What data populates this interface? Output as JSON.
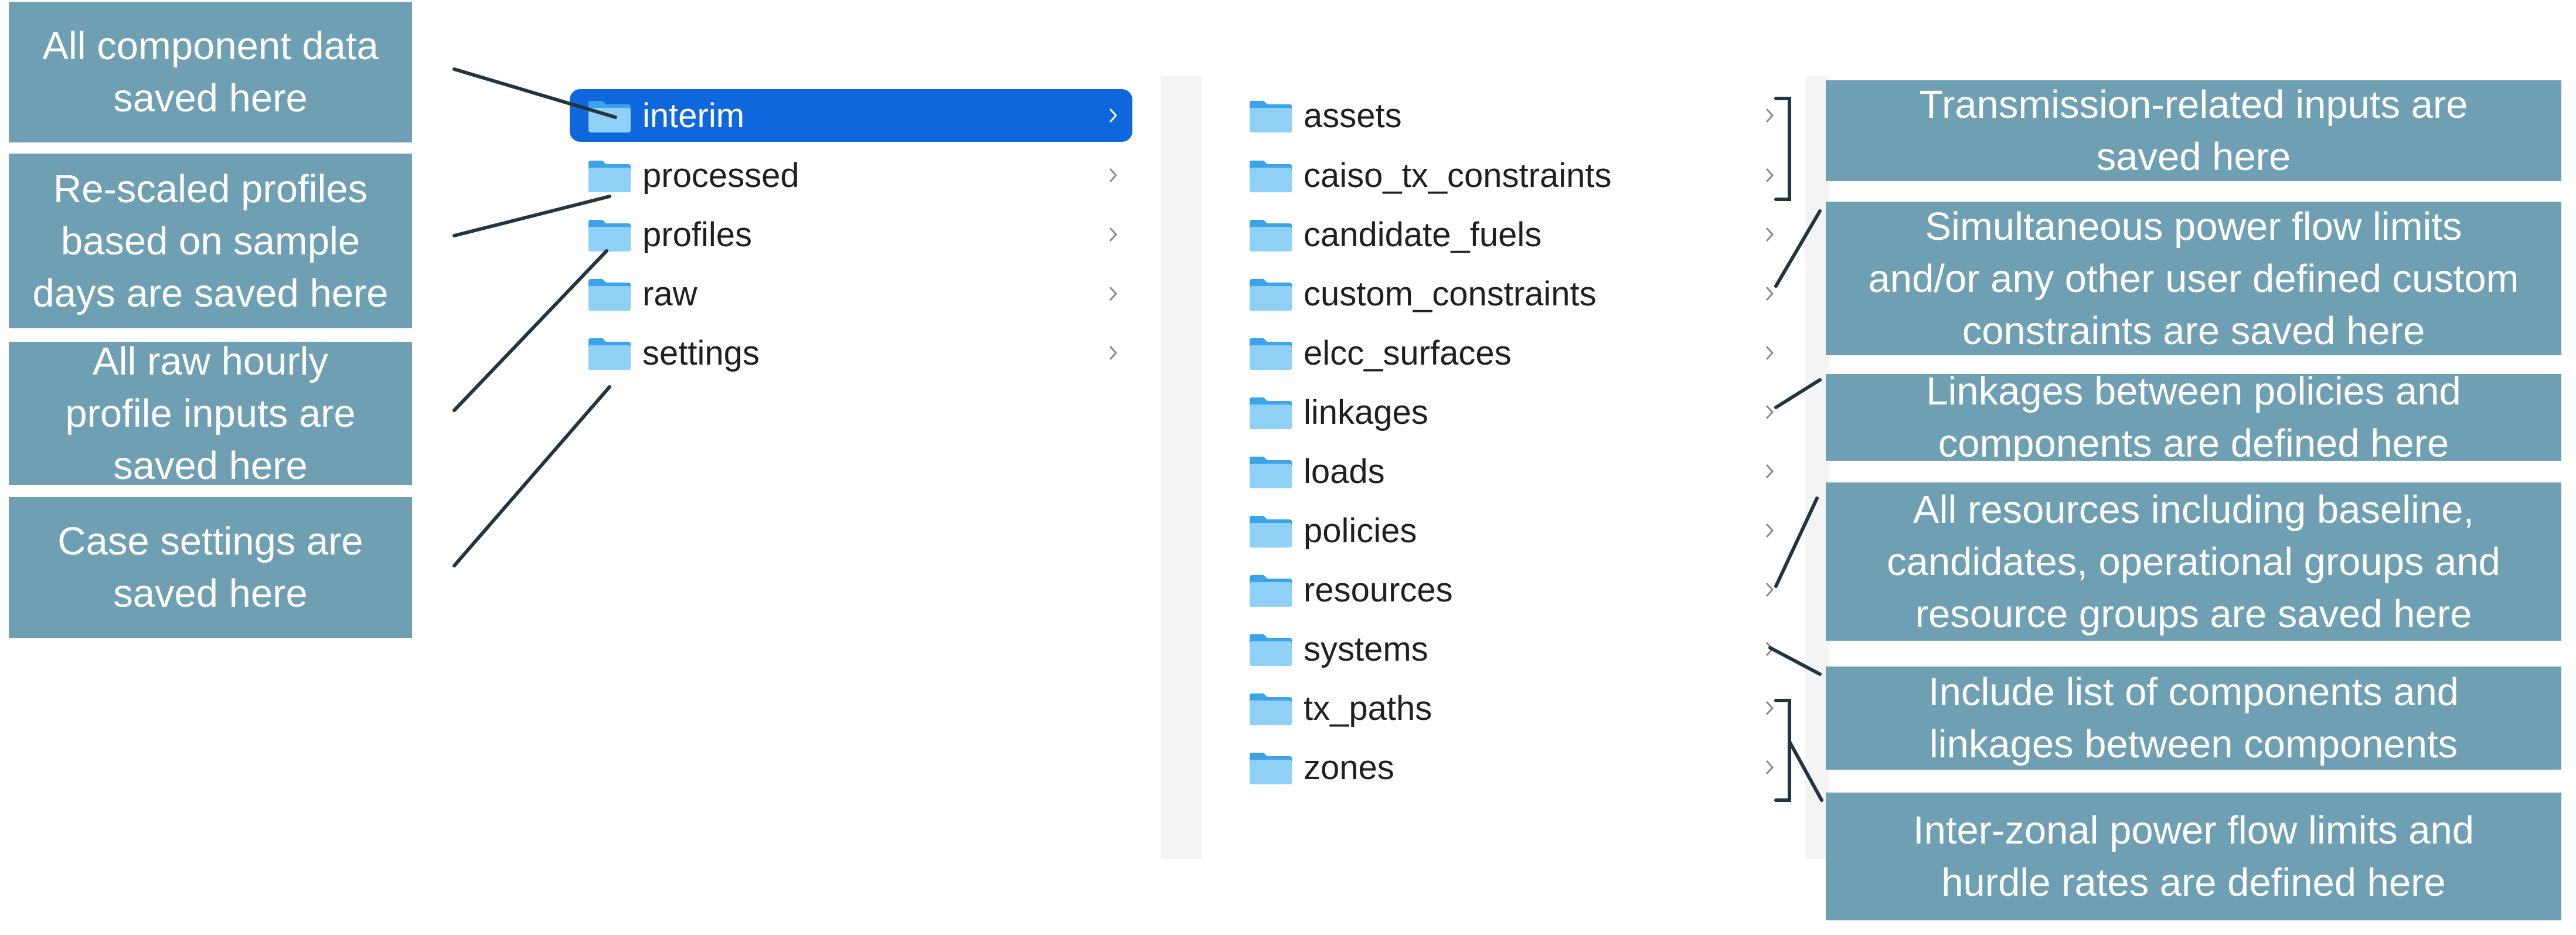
{
  "left_pane": {
    "items": [
      {
        "label": "interim",
        "selected": true
      },
      {
        "label": "processed",
        "selected": false
      },
      {
        "label": "profiles",
        "selected": false
      },
      {
        "label": "raw",
        "selected": false
      },
      {
        "label": "settings",
        "selected": false
      }
    ]
  },
  "right_pane": {
    "items": [
      {
        "label": "assets"
      },
      {
        "label": "caiso_tx_constraints"
      },
      {
        "label": "candidate_fuels"
      },
      {
        "label": "custom_constraints"
      },
      {
        "label": "elcc_surfaces"
      },
      {
        "label": "linkages"
      },
      {
        "label": "loads"
      },
      {
        "label": "policies"
      },
      {
        "label": "resources"
      },
      {
        "label": "systems"
      },
      {
        "label": "tx_paths"
      },
      {
        "label": "zones"
      }
    ]
  },
  "left_callouts": [
    {
      "lines": [
        "All component data",
        "saved here"
      ]
    },
    {
      "lines": [
        "Re-scaled profiles",
        "based on sample",
        "days are saved here"
      ]
    },
    {
      "lines": [
        "All raw hourly",
        "profile inputs are",
        "saved here"
      ]
    },
    {
      "lines": [
        "Case settings are",
        "saved here"
      ]
    }
  ],
  "right_callouts": [
    {
      "lines": [
        "Transmission-related inputs are",
        "saved here"
      ]
    },
    {
      "lines": [
        "Simultaneous power flow limits",
        "and/or any other user defined custom",
        "constraints are saved here"
      ]
    },
    {
      "lines": [
        "Linkages between policies and",
        "components are defined here"
      ]
    },
    {
      "lines": [
        "All resources including baseline,",
        "candidates, operational groups and",
        "resource groups are saved here"
      ]
    },
    {
      "lines": [
        "Include list of components and",
        "linkages between components"
      ]
    },
    {
      "lines": [
        "Inter-zonal power flow limits and",
        "hurdle rates are defined here"
      ]
    }
  ],
  "colors": {
    "callout_bg": "#6e9fb2",
    "selection": "#0e67dc",
    "folder_light": "#8fd0f7",
    "folder_dark": "#3aa3ea",
    "connector": "#22343f"
  },
  "icons": {
    "folder": "folder-icon",
    "chevron": "chevron-right-icon"
  }
}
